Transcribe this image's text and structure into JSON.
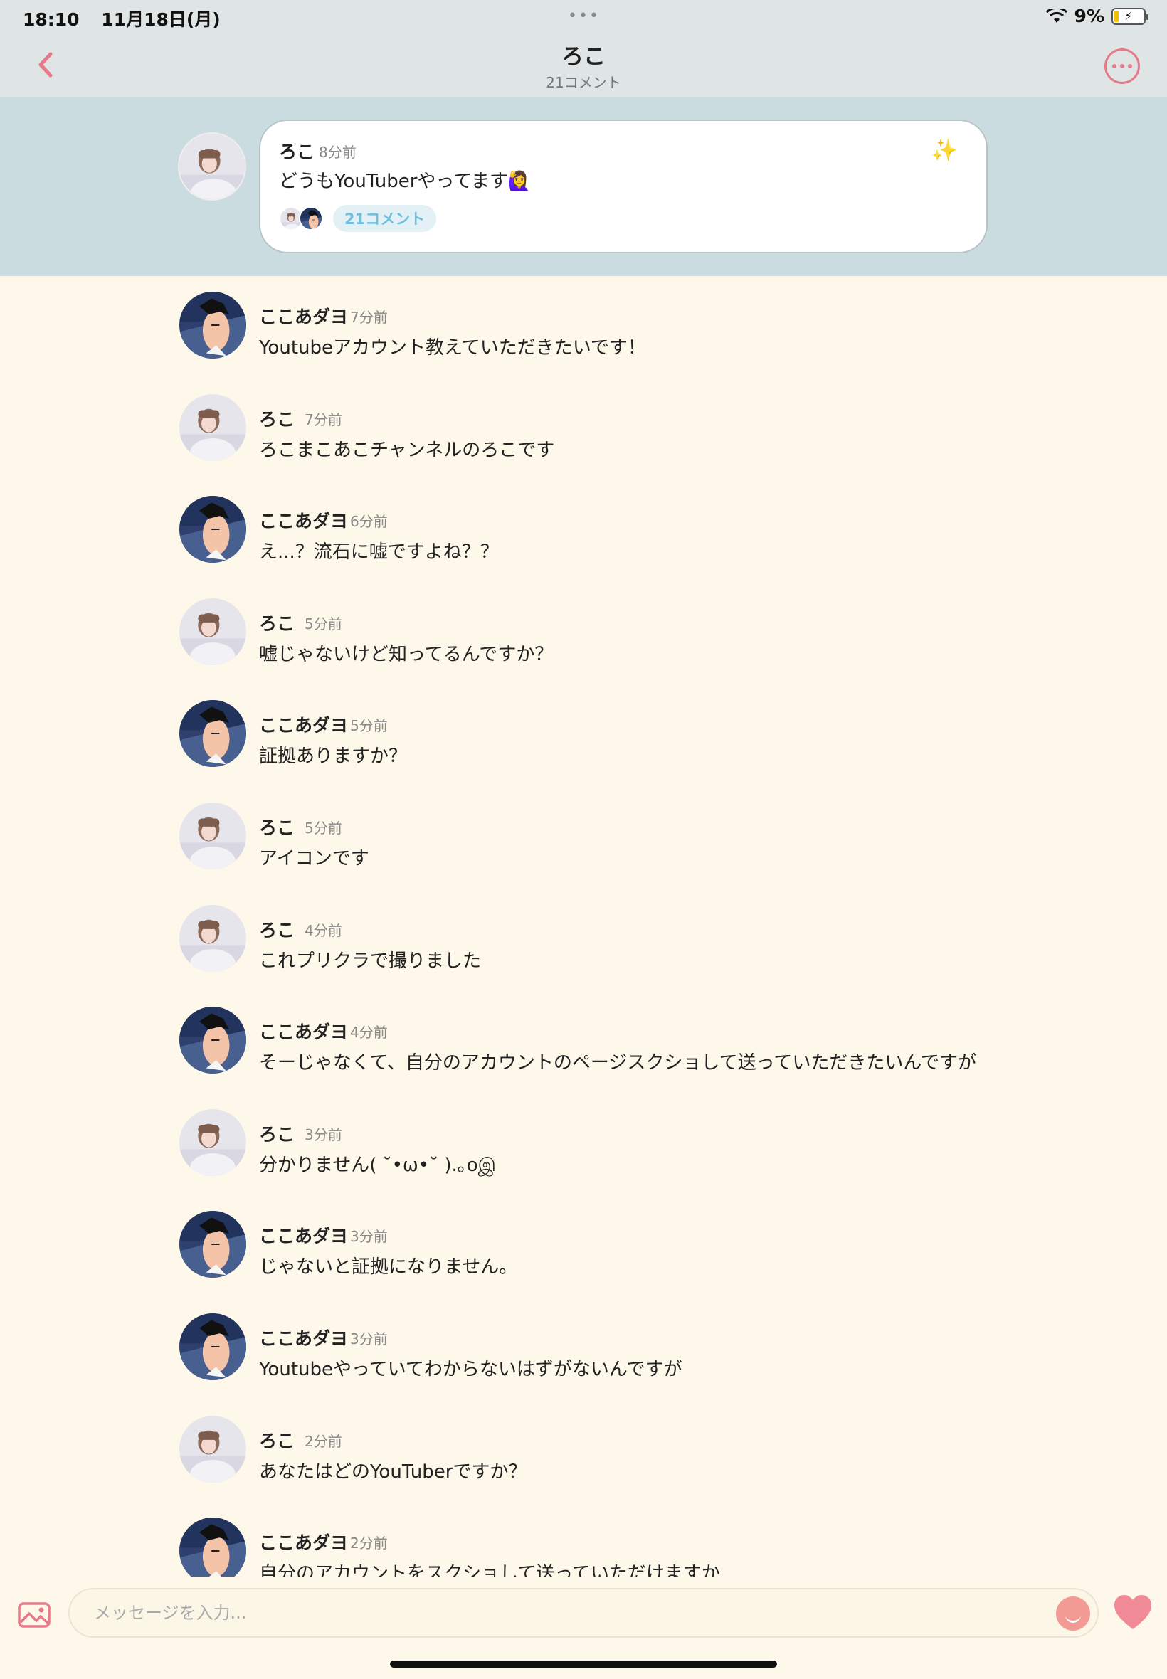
{
  "status": {
    "time": "18:10",
    "date": "11月18日(月)",
    "dots": "•••",
    "battery": "9%"
  },
  "header": {
    "title": "ろこ",
    "subtitle": "21コメント"
  },
  "post": {
    "author": "ろこ",
    "time": "8分前",
    "text": "どうもYouTuberやってます🙋‍♀️",
    "sparkle": "✨",
    "comment_badge": "21コメント"
  },
  "comments": [
    {
      "author": "ここあダヨ",
      "time": "7分前",
      "text": "Youtubeアカウント教えていただきたいです！",
      "who": "koko"
    },
    {
      "author": "ろこ",
      "time": "7分前",
      "text": "ろこまこあこチャンネルのろこです",
      "who": "roko"
    },
    {
      "author": "ここあダヨ",
      "time": "6分前",
      "text": "え...？流石に嘘ですよね？？",
      "who": "koko"
    },
    {
      "author": "ろこ",
      "time": "5分前",
      "text": "嘘じゃないけど知ってるんですか？",
      "who": "roko"
    },
    {
      "author": "ここあダヨ",
      "time": "5分前",
      "text": "証拠ありますか？",
      "who": "koko"
    },
    {
      "author": "ろこ",
      "time": "5分前",
      "text": "アイコンです",
      "who": "roko"
    },
    {
      "author": "ろこ",
      "time": "4分前",
      "text": "これプリクラで撮りました",
      "who": "roko"
    },
    {
      "author": "ここあダヨ",
      "time": "4分前",
      "text": "そーじゃなくて、自分のアカウントのページスクショして送っていただきたいんですが",
      "who": "koko"
    },
    {
      "author": "ろこ",
      "time": "3分前",
      "text": "分かりません( ˘•ω•˘ ).｡oஇ",
      "who": "roko"
    },
    {
      "author": "ここあダヨ",
      "time": "3分前",
      "text": "じゃないと証拠になりません。",
      "who": "koko"
    },
    {
      "author": "ここあダヨ",
      "time": "3分前",
      "text": "Youtubeやっていてわからないはずがないんですが",
      "who": "koko"
    },
    {
      "author": "ろこ",
      "time": "2分前",
      "text": "あなたはどのYouTuberですか？",
      "who": "roko"
    },
    {
      "author": "ここあダヨ",
      "time": "2分前",
      "text": "自分のアカウントをスクショして送っていただけますか",
      "who": "koko"
    }
  ],
  "input": {
    "placeholder": "メッセージを入力..."
  },
  "colors": {
    "accent": "#e77a8a",
    "header_bg": "#dfe4e4",
    "post_bg": "#cadcdf",
    "page_bg": "#fdf8ea",
    "badge_text": "#6fc0de"
  },
  "icons": {
    "back": "chevron-left-icon",
    "more": "more-horizontal-icon",
    "image": "image-icon",
    "emoji": "smile-icon",
    "like": "heart-icon"
  }
}
